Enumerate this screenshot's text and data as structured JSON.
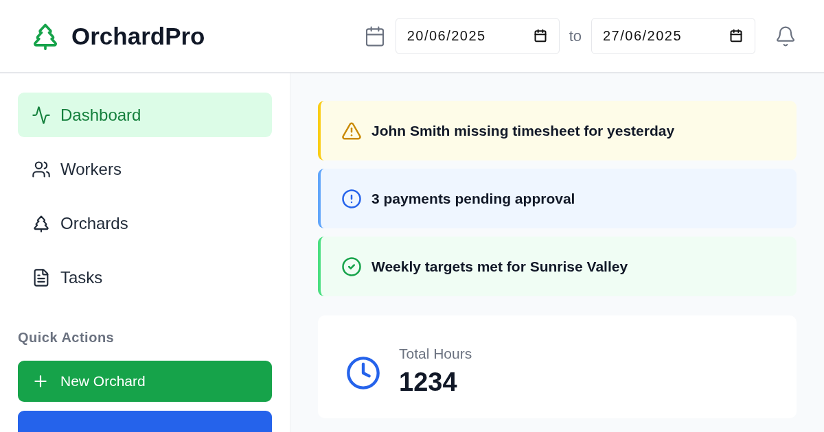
{
  "brand": {
    "name": "OrchardPro"
  },
  "date_range": {
    "from": "20/06/2025",
    "separator": "to",
    "to": "27/06/2025"
  },
  "nav": [
    {
      "label": "Dashboard",
      "selected": true
    },
    {
      "label": "Workers",
      "selected": false
    },
    {
      "label": "Orchards",
      "selected": false
    },
    {
      "label": "Tasks",
      "selected": false
    }
  ],
  "quick_actions": {
    "title": "Quick Actions",
    "items": [
      {
        "label": "New Orchard",
        "color": "#16a34a"
      },
      {
        "color": "#2563eb"
      }
    ]
  },
  "alerts": [
    {
      "kind": "warning",
      "text": "John Smith missing timesheet for yesterday"
    },
    {
      "kind": "info",
      "text": "3 payments pending approval"
    },
    {
      "kind": "success",
      "text": "Weekly targets met for Sunrise Valley"
    }
  ],
  "stats": [
    {
      "label": "Total Hours",
      "value": "1234"
    }
  ]
}
